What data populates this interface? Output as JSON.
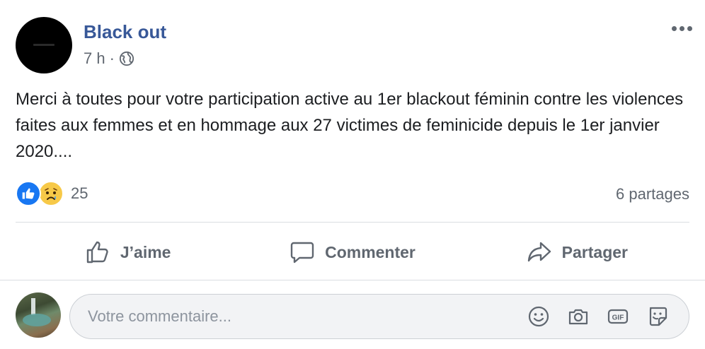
{
  "post": {
    "author": "Black out",
    "time": "7 h",
    "separator": "·",
    "visibility_icon": "globe-icon",
    "message": "Merci à toutes pour votre participation active au 1er blackout féminin contre les violences faites aux femmes et en hommage aux 27 victimes de feminicide depuis le 1er janvier 2020....",
    "reactions": {
      "icons": [
        "like-reaction-icon",
        "sad-reaction-icon"
      ],
      "count": "25"
    },
    "shares": "6 partages"
  },
  "actions": {
    "like_label": "J’aime",
    "comment_label": "Commenter",
    "share_label": "Partager"
  },
  "comment": {
    "placeholder": "Votre commentaire...",
    "icons": [
      "emoji-icon",
      "camera-icon",
      "gif-icon",
      "sticker-icon"
    ]
  },
  "colors": {
    "author": "#385898",
    "like_blue": "#1877f2",
    "muted": "#606770",
    "divider": "#dadde1",
    "input_bg": "#f2f3f5"
  }
}
